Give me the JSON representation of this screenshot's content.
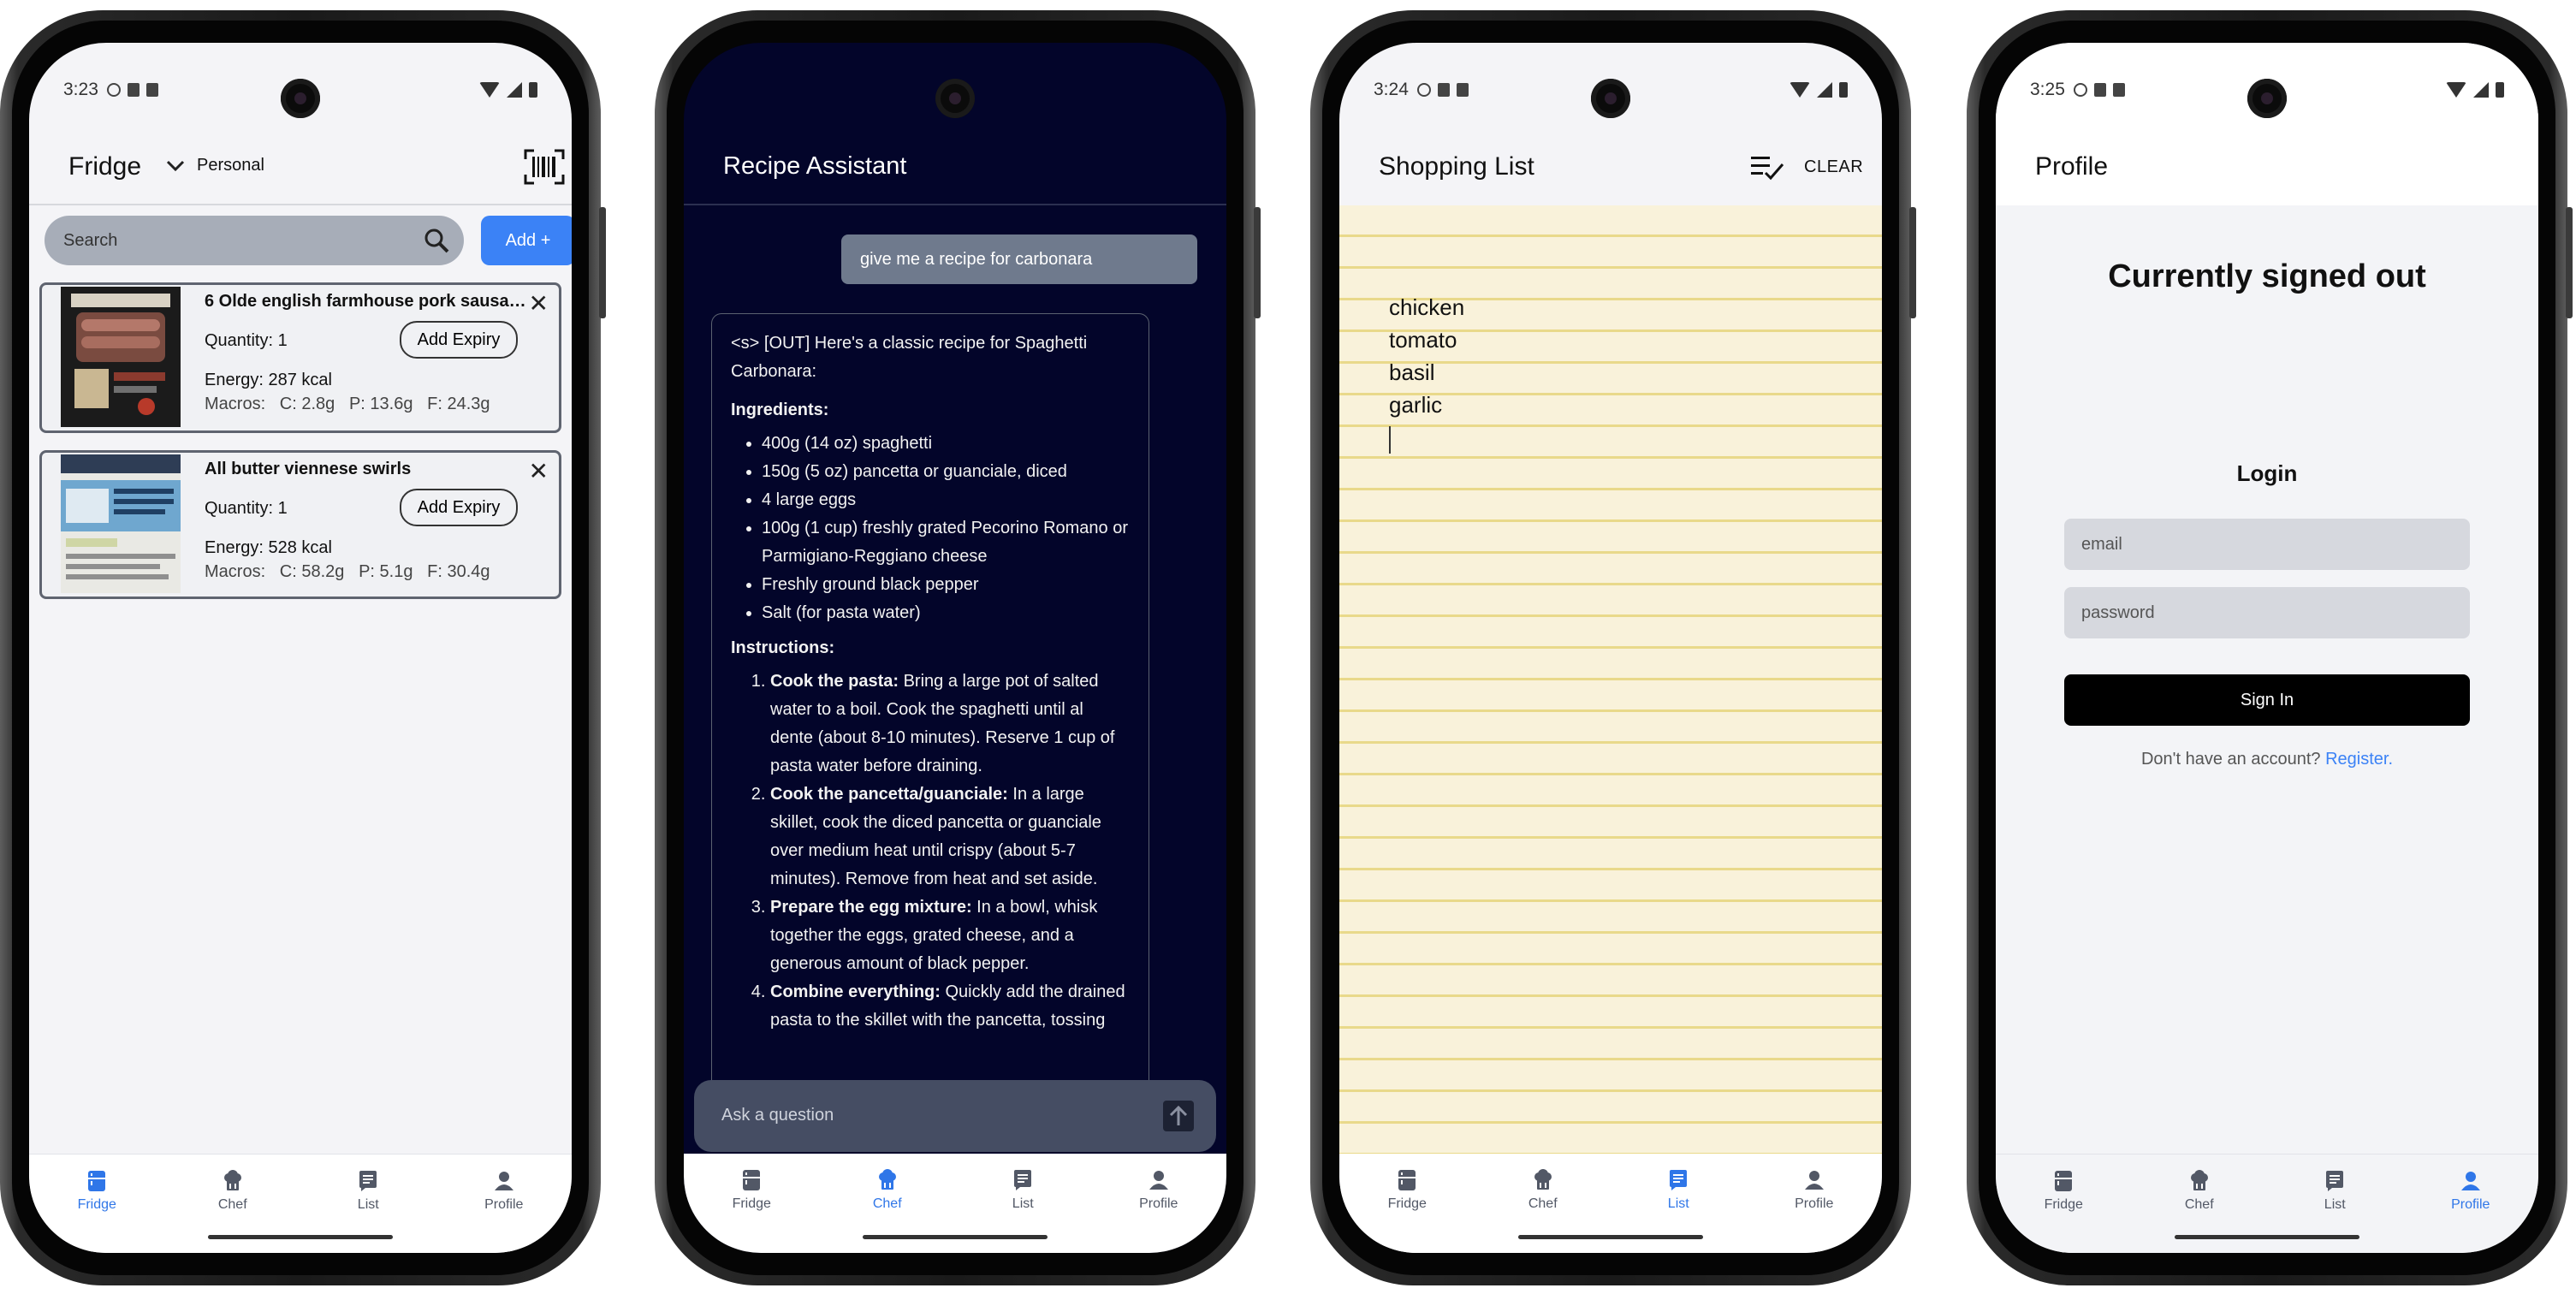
{
  "status": {
    "fridge_time": "3:23",
    "list_time": "3:24",
    "profile_time": "3:25"
  },
  "nav": {
    "fridge": "Fridge",
    "chef": "Chef",
    "list": "List",
    "profile": "Profile",
    "active_color": "#2f76e8",
    "inactive_color": "#525866"
  },
  "fridge": {
    "title": "Fridge",
    "selector_value": "Personal",
    "search_placeholder": "Search",
    "add_label": "Add +",
    "items": [
      {
        "name": "6 Olde english farmhouse pork sausag...",
        "quantity": "Quantity: 1",
        "expiry_label": "Add Expiry",
        "energy": "Energy: 287 kcal",
        "macros": "Macros:   C: 2.8g   P: 13.6g   F: 24.3g"
      },
      {
        "name": "All butter viennese swirls",
        "quantity": "Quantity: 1",
        "expiry_label": "Add Expiry",
        "energy": "Energy: 528 kcal",
        "macros": "Macros:   C: 58.2g   P: 5.1g   F: 30.4g"
      }
    ]
  },
  "chef": {
    "title": "Recipe Assistant",
    "user_message": "give me a recipe for carbonara",
    "reply_intro": "<s> [OUT] Here's a classic recipe for Spaghetti Carbonara:",
    "ingredients_heading": "Ingredients:",
    "ingredients": [
      "400g (14 oz) spaghetti",
      "150g (5 oz) pancetta or guanciale, diced",
      "4 large eggs",
      "100g (1 cup) freshly grated Pecorino Romano or Parmigiano-Reggiano cheese",
      "Freshly ground black pepper",
      "Salt (for pasta water)"
    ],
    "instructions_heading": "Instructions:",
    "steps": [
      {
        "bold": "Cook the pasta:",
        "text": " Bring a large pot of salted water to a boil. Cook the spaghetti until al dente (about 8-10 minutes). Reserve 1 cup of pasta water before draining."
      },
      {
        "bold": "Cook the pancetta/guanciale:",
        "text": " In a large skillet, cook the diced pancetta or guanciale over medium heat until crispy (about 5-7 minutes). Remove from heat and set aside."
      },
      {
        "bold": "Prepare the egg mixture:",
        "text": " In a bowl, whisk together the eggs, grated cheese, and a generous amount of black pepper."
      },
      {
        "bold": "Combine everything:",
        "text": " Quickly add the drained pasta to the skillet with the pancetta, tossing"
      }
    ],
    "ask_placeholder": "Ask a question"
  },
  "shopping": {
    "title": "Shopping List",
    "clear_label": "CLEAR",
    "items": [
      "chicken",
      "tomato",
      "basil",
      "garlic"
    ]
  },
  "profile": {
    "title": "Profile",
    "status_heading": "Currently signed out",
    "login_heading": "Login",
    "email_placeholder": "email",
    "password_placeholder": "password",
    "signin_label": "Sign In",
    "register_prompt": "Don't have an account?",
    "register_link": "Register."
  }
}
